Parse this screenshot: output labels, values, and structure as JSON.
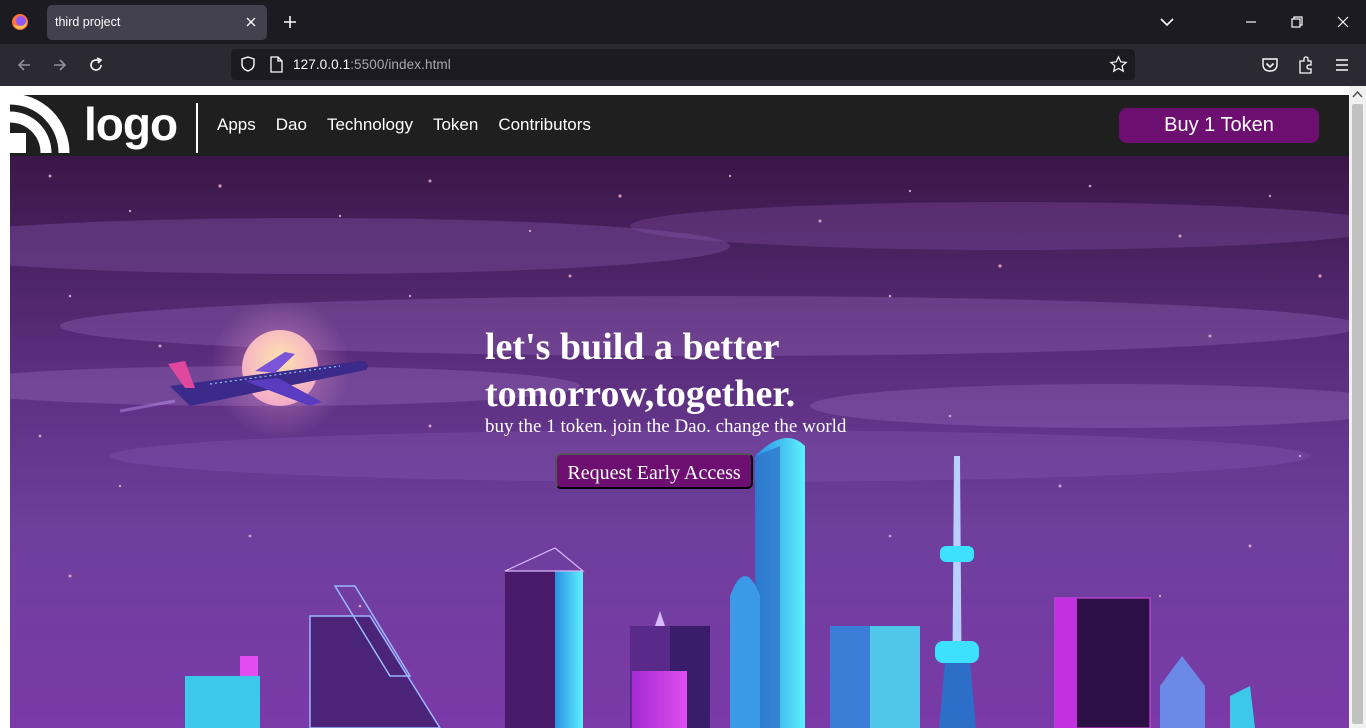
{
  "browser": {
    "tab_title": "third project",
    "url_host": "127.0.0.1",
    "url_rest": ":5500/index.html"
  },
  "site": {
    "logo_text": "logo",
    "nav": [
      "Apps",
      "Dao",
      "Technology",
      "Token",
      "Contributors"
    ],
    "buy_button": "Buy 1 Token",
    "headline": "let's build a better tomorrow,together.",
    "subline": "buy the 1 token. join the Dao. change the world",
    "cta": "Request Early Access"
  },
  "colors": {
    "browser_bg": "#1c1b22",
    "toolbar_bg": "#2b2a33",
    "header_bg": "#1f1f1f",
    "accent_purple": "#6d0f70",
    "sky_top": "#3a1a55",
    "sky_mid": "#6b3f95"
  }
}
